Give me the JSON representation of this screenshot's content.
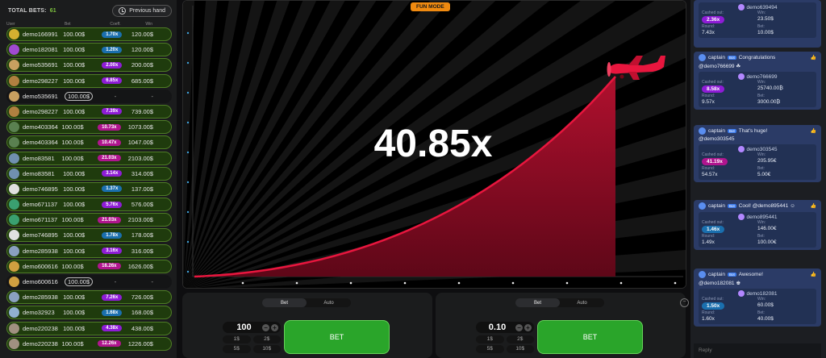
{
  "header": {
    "total_label": "TOTAL BETS:",
    "total_count": "61",
    "prev_hand": "Previous hand"
  },
  "columns": {
    "user": "User",
    "bet": "Bet",
    "coeff": "Coeff.",
    "win": "Win"
  },
  "bets": [
    {
      "user": "demo166991",
      "bet": "100.00$",
      "coeff": "1.70x",
      "win": "120.00$",
      "color": "blue",
      "state": "won",
      "avatar": "#d4b030"
    },
    {
      "user": "demo182081",
      "bet": "100.00$",
      "coeff": "1.20x",
      "win": "120.00$",
      "color": "blue",
      "state": "won",
      "avatar": "#a04ad0"
    },
    {
      "user": "demo535691",
      "bet": "100.00$",
      "coeff": "2.00x",
      "win": "200.00$",
      "color": "purple",
      "state": "won",
      "avatar": "#c8a060"
    },
    {
      "user": "demo298227",
      "bet": "100.00$",
      "coeff": "6.85x",
      "win": "685.00$",
      "color": "purple",
      "state": "won",
      "avatar": "#b08040"
    },
    {
      "user": "demo535691",
      "bet": "100.00$",
      "coeff": "-",
      "win": "-",
      "color": "",
      "state": "pending",
      "avatar": "#c8a060"
    },
    {
      "user": "demo298227",
      "bet": "100.00$",
      "coeff": "7.39x",
      "win": "739.00$",
      "color": "purple",
      "state": "won",
      "avatar": "#b08040"
    },
    {
      "user": "demo403364",
      "bet": "100.00$",
      "coeff": "10.73x",
      "win": "1073.00$",
      "color": "magenta",
      "state": "won",
      "avatar": "#5a8050"
    },
    {
      "user": "demo403364",
      "bet": "100.00$",
      "coeff": "10.47x",
      "win": "1047.00$",
      "color": "magenta",
      "state": "won",
      "avatar": "#5a8050"
    },
    {
      "user": "demo83581",
      "bet": "100.00$",
      "coeff": "21.03x",
      "win": "2103.00$",
      "color": "magenta",
      "state": "won",
      "avatar": "#7090b0"
    },
    {
      "user": "demo83581",
      "bet": "100.00$",
      "coeff": "3.14x",
      "win": "314.00$",
      "color": "purple",
      "state": "won",
      "avatar": "#7090b0"
    },
    {
      "user": "demo746895",
      "bet": "100.00$",
      "coeff": "1.37x",
      "win": "137.00$",
      "color": "blue",
      "state": "won",
      "avatar": "#e0e0e0"
    },
    {
      "user": "demo671137",
      "bet": "100.00$",
      "coeff": "5.76x",
      "win": "576.00$",
      "color": "purple",
      "state": "won",
      "avatar": "#3aa070"
    },
    {
      "user": "demo671137",
      "bet": "100.00$",
      "coeff": "21.03x",
      "win": "2103.00$",
      "color": "magenta",
      "state": "won",
      "avatar": "#3aa070"
    },
    {
      "user": "demo746895",
      "bet": "100.00$",
      "coeff": "1.78x",
      "win": "178.00$",
      "color": "blue",
      "state": "won",
      "avatar": "#e0e0e0"
    },
    {
      "user": "demo285938",
      "bet": "100.00$",
      "coeff": "3.16x",
      "win": "316.00$",
      "color": "purple",
      "state": "won",
      "avatar": "#8aa0c0"
    },
    {
      "user": "demo600616",
      "bet": "100.00$",
      "coeff": "16.26x",
      "win": "1626.00$",
      "color": "magenta",
      "state": "won",
      "avatar": "#d0a040"
    },
    {
      "user": "demo600616",
      "bet": "100.00$",
      "coeff": "-",
      "win": "-",
      "color": "",
      "state": "pending",
      "avatar": "#d0a040"
    },
    {
      "user": "demo285938",
      "bet": "100.00$",
      "coeff": "7.26x",
      "win": "726.00$",
      "color": "purple",
      "state": "won",
      "avatar": "#8aa0c0"
    },
    {
      "user": "demo32923",
      "bet": "100.00$",
      "coeff": "1.68x",
      "win": "168.00$",
      "color": "blue",
      "state": "won",
      "avatar": "#90b0d0"
    },
    {
      "user": "demo220238",
      "bet": "100.00$",
      "coeff": "4.38x",
      "win": "438.00$",
      "color": "purple",
      "state": "won",
      "avatar": "#a09080"
    },
    {
      "user": "demo220238",
      "bet": "100.00$",
      "coeff": "12.26x",
      "win": "1226.00$",
      "color": "magenta",
      "state": "won",
      "avatar": "#a09080"
    }
  ],
  "game": {
    "mode": "FUN MODE",
    "multiplier": "40.85x",
    "curve_color": "#e8163e"
  },
  "controls": [
    {
      "tab_bet": "Bet",
      "tab_auto": "Auto",
      "amount": "100",
      "quick": [
        "1$",
        "2$",
        "5$",
        "10$"
      ],
      "bet_label": "BET"
    },
    {
      "tab_bet": "Bet",
      "tab_auto": "Auto",
      "amount": "0.10",
      "quick": [
        "1$",
        "2$",
        "5$",
        "10$"
      ],
      "bet_label": "BET"
    }
  ],
  "chat": {
    "labels": {
      "cashed": "Cashed out:",
      "win": "Win:",
      "round": "Round:",
      "bet": "Bet:"
    },
    "reply_placeholder": "Reply",
    "top_card": {
      "user": "demo639494",
      "cashed": "2.36x",
      "win": "23.50$",
      "round": "7.43x",
      "bet": "10.00$"
    },
    "cards": [
      {
        "sender": "captain",
        "badge": "Bot",
        "text": "Congratulations",
        "mention": "@demo766699 ☘",
        "user": "demo766699",
        "cashed": "8.58x",
        "win": "25740.00₿",
        "round": "9.57x",
        "bet": "3000.00₿",
        "pill": "#8e1cd6"
      },
      {
        "sender": "captain",
        "badge": "Bot",
        "text": "That's huge!",
        "mention": "@demo303545",
        "user": "demo303545",
        "cashed": "41.19x",
        "win": "205.95€",
        "round": "54.57x",
        "bet": "5.00€",
        "pill": "#b0158e"
      },
      {
        "sender": "captain",
        "badge": "Bot",
        "text": "Cool! @demo895441 ☺",
        "mention": "",
        "user": "demo895441",
        "cashed": "1.46x",
        "win": "146.00€",
        "round": "1.49x",
        "bet": "100.00€",
        "pill": "#1a6fae"
      },
      {
        "sender": "captain",
        "badge": "Bot",
        "text": "Awesome!",
        "mention": "@demo182081 ♚",
        "user": "demo182081",
        "cashed": "1.50x",
        "win": "60.00$",
        "round": "1.60x",
        "bet": "40.00$",
        "pill": "#1a6fae"
      }
    ]
  }
}
